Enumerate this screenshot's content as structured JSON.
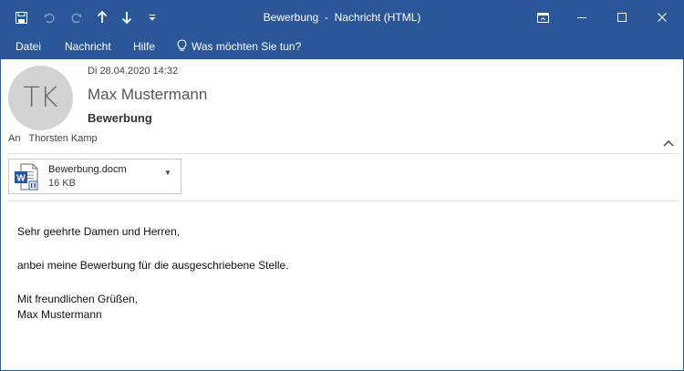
{
  "window": {
    "title": "Bewerbung  -  Nachricht (HTML)"
  },
  "quick_access": {
    "icons": [
      "save-icon",
      "undo-icon",
      "redo-icon",
      "previous-item-icon",
      "next-item-icon",
      "customize-toolbar-icon"
    ]
  },
  "menu": {
    "items": [
      "Datei",
      "Nachricht",
      "Hilfe"
    ],
    "tell_me": "Was möchten Sie tun?"
  },
  "header": {
    "avatar_initials": "TK",
    "date": "Di 28.04.2020 14:32",
    "sender": "Max Mustermann",
    "subject": "Bewerbung",
    "to_label": "An",
    "to_value": "Thorsten Kamp"
  },
  "attachment": {
    "name": "Bewerbung.docm",
    "size": "16 KB",
    "icon": "word-macro-document-icon"
  },
  "body": {
    "greeting": "Sehr geehrte Damen und Herren,",
    "line1": "anbei meine Bewerbung für die ausgeschriebene Stelle.",
    "closing": "Mit freundlichen Grüßen,",
    "signature": "Max Mustermann"
  },
  "colors": {
    "titlebar": "#2b579a",
    "avatar": "#d3d3d3",
    "word_blue": "#2b579a"
  }
}
